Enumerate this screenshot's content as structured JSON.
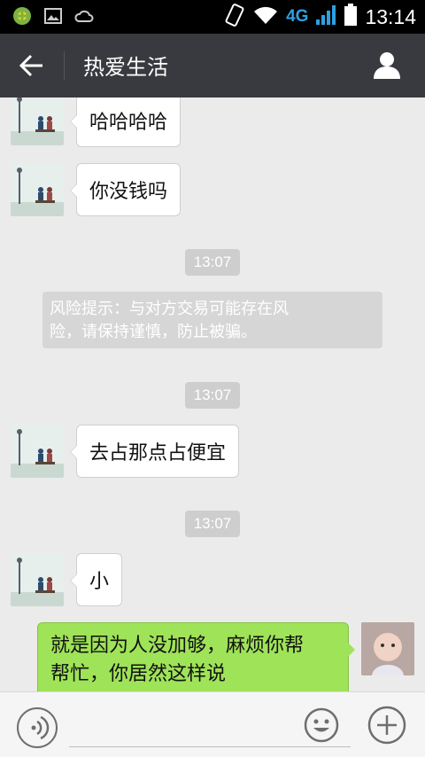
{
  "status_bar": {
    "network": "4G",
    "time": "13:14",
    "icons": [
      "app-notification-icon",
      "image-icon",
      "weather-icon",
      "vibrate-icon",
      "wifi-icon",
      "signal-icon",
      "battery-icon"
    ]
  },
  "header": {
    "title": "热爱生活",
    "back_icon": "arrow-left-icon",
    "profile_icon": "person-icon"
  },
  "messages": [
    {
      "side": "left",
      "text": "哈哈哈哈"
    },
    {
      "side": "left",
      "text": "你没钱吗"
    },
    {
      "type": "time",
      "text": "13:07"
    },
    {
      "type": "system",
      "text": "风险提示：与对方交易可能存在风险，请保持谨慎，防止被骗。",
      "line1": "风险提示：与对方交易可能存在风",
      "line2": "险，请保持谨慎，防止被骗。"
    },
    {
      "type": "time",
      "text": "13:07"
    },
    {
      "side": "left",
      "text": "去占那点占便宜"
    },
    {
      "type": "time",
      "text": "13:07"
    },
    {
      "side": "left",
      "text": "小"
    },
    {
      "side": "right",
      "text": "就是因为人没加够，麻烦你帮帮忙，你居然这样说",
      "line1": "就是因为人没加够，麻烦你帮",
      "line2": "帮忙，你居然这样说"
    }
  ],
  "input_bar": {
    "placeholder": "",
    "voice_icon": "voice-icon",
    "emoji_icon": "emoji-icon",
    "plus_icon": "plus-icon"
  },
  "colors": {
    "title_bar": "#393a3f",
    "chat_bg": "#ebebeb",
    "sent_bubble": "#9fe358",
    "received_bubble": "#ffffff",
    "timestamp_bg": "#cecece"
  }
}
